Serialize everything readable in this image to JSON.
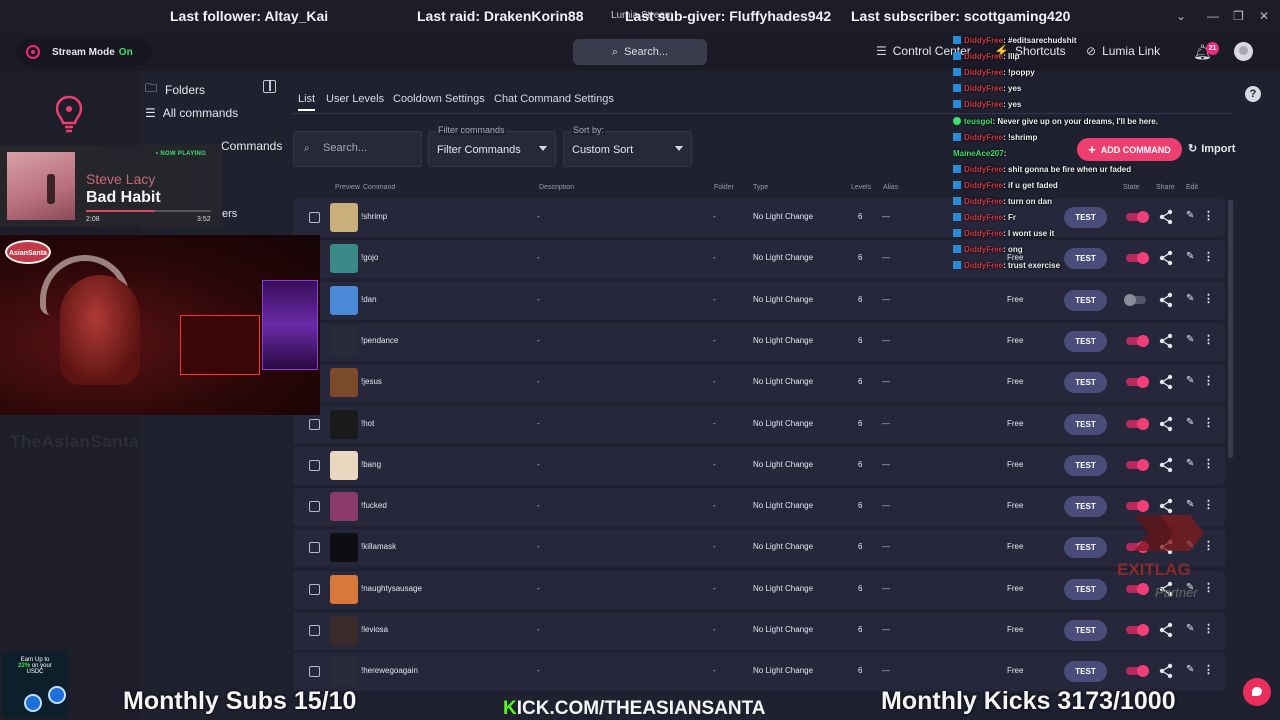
{
  "stream_stats": {
    "last_follower": "Last follower: Altay_Kai",
    "last_raid": "Last raid: DrakenKorin88",
    "last_sub_giver": "Last sub-giver: Fluffyhades942",
    "last_subscriber": "Last subscriber: scottgaming420",
    "app_title": "Lumia Stream"
  },
  "header": {
    "stream_mode_label": "Stream Mode",
    "stream_mode_state": "On",
    "search_label": "Search...",
    "control_center": "Control Center",
    "shortcuts": "Shortcuts",
    "lumia_link": "Lumia Link",
    "notification_count": "21"
  },
  "sidebar": {
    "folders_label": "Folders",
    "all_commands": "All commands",
    "chat_commands_partial": "Commands",
    "partial_item": "ers"
  },
  "now_playing": {
    "badge": "• NOW PLAYING",
    "artist": "Steve Lacy",
    "song": "Bad Habit",
    "elapsed": "2:08",
    "duration": "3:52",
    "progress": 0.55
  },
  "webcam": {
    "logo_text": "AsianSanta",
    "ghost_text": "TheAsianSanta"
  },
  "promo": {
    "line1": "Earn Up to",
    "line2_highlight": "22%",
    "line2_rest": "on your",
    "line3": "USDC"
  },
  "tabs": [
    "List",
    "User Levels",
    "Cooldown Settings",
    "Chat Command Settings"
  ],
  "filters": {
    "search_placeholder": "Search...",
    "filter_label": "Filter commands",
    "filter_value": "Filter Commands",
    "sort_label": "Sort by:",
    "sort_value": "Custom Sort"
  },
  "actions": {
    "add_command": "ADD COMMAND",
    "import": "Import"
  },
  "columns": {
    "preview": "Preview",
    "command": "Command",
    "description": "Description",
    "folder": "Folder",
    "type": "Type",
    "levels": "Levels",
    "alias": "Alias",
    "state": "State",
    "share": "Share",
    "edit": "Edit"
  },
  "rows": [
    {
      "name": "!shrimp",
      "desc": "-",
      "folder": "-",
      "type": "No Light Change",
      "levels": "6",
      "alias": "—",
      "perm": "",
      "test": "TEST",
      "enabled": true,
      "thumb": "#c9b07a"
    },
    {
      "name": "!gojo",
      "desc": "-",
      "folder": "-",
      "type": "No Light Change",
      "levels": "6",
      "alias": "—",
      "perm": "Free",
      "test": "TEST",
      "enabled": true,
      "thumb": "#3a8a8a"
    },
    {
      "name": "!dan",
      "desc": "-",
      "folder": "-",
      "type": "No Light Change",
      "levels": "6",
      "alias": "—",
      "perm": "Free",
      "test": "TEST",
      "enabled": false,
      "thumb": "#4a8ad8"
    },
    {
      "name": "!pendance",
      "desc": "-",
      "folder": "-",
      "type": "No Light Change",
      "levels": "6",
      "alias": "—",
      "perm": "Free",
      "test": "TEST",
      "enabled": true,
      "thumb": "#2a2b3a"
    },
    {
      "name": "!jesus",
      "desc": "-",
      "folder": "-",
      "type": "No Light Change",
      "levels": "6",
      "alias": "—",
      "perm": "Free",
      "test": "TEST",
      "enabled": true,
      "thumb": "#7a4a2a"
    },
    {
      "name": "!hot",
      "desc": "-",
      "folder": "-",
      "type": "No Light Change",
      "levels": "6",
      "alias": "—",
      "perm": "Free",
      "test": "TEST",
      "enabled": true,
      "thumb": "#1a1a1a"
    },
    {
      "name": "!bang",
      "desc": "-",
      "folder": "-",
      "type": "No Light Change",
      "levels": "6",
      "alias": "—",
      "perm": "Free",
      "test": "TEST",
      "enabled": true,
      "thumb": "#e8d8c0"
    },
    {
      "name": "!fucked",
      "desc": "-",
      "folder": "-",
      "type": "No Light Change",
      "levels": "6",
      "alias": "—",
      "perm": "Free",
      "test": "TEST",
      "enabled": true,
      "thumb": "#8a3a6a"
    },
    {
      "name": "!killamask",
      "desc": "-",
      "folder": "-",
      "type": "No Light Change",
      "levels": "6",
      "alias": "—",
      "perm": "Free",
      "test": "TEST",
      "enabled": true,
      "thumb": "#0e0e12"
    },
    {
      "name": "!naughtysausage",
      "desc": "-",
      "folder": "-",
      "type": "No Light Change",
      "levels": "6",
      "alias": "—",
      "perm": "Free",
      "test": "TEST",
      "enabled": true,
      "thumb": "#d8783a"
    },
    {
      "name": "!leviosa",
      "desc": "-",
      "folder": "-",
      "type": "No Light Change",
      "levels": "6",
      "alias": "—",
      "perm": "Free",
      "test": "TEST",
      "enabled": true,
      "thumb": "#3a2a2a"
    },
    {
      "name": "!herewegoagain",
      "desc": "-",
      "folder": "-",
      "type": "No Light Change",
      "levels": "6",
      "alias": "—",
      "perm": "Free",
      "test": "TEST",
      "enabled": true,
      "thumb": "#2a2b3a"
    }
  ],
  "chat": [
    {
      "user": "DiddyFree",
      "msg": ": #editsarechudshit",
      "badge": "blue",
      "user_color": "red"
    },
    {
      "user": "DiddyFree",
      "msg": ": lllp",
      "badge": "blue",
      "user_color": "red"
    },
    {
      "user": "DiddyFree",
      "msg": ": !poppy",
      "badge": "blue",
      "user_color": "red"
    },
    {
      "user": "DiddyFree",
      "msg": ": yes",
      "badge": "blue",
      "user_color": "red"
    },
    {
      "user": "DiddyFree",
      "msg": ": yes",
      "badge": "blue",
      "user_color": "red"
    },
    {
      "user": "teusgol",
      "msg": ": Never give up on your dreams, I'll be here.",
      "badge": "green",
      "user_color": "green"
    },
    {
      "user": "DiddyFree",
      "msg": ": !shrimp",
      "badge": "blue",
      "user_color": "red"
    },
    {
      "user": "MaineAce207",
      "msg": ":",
      "badge": "none",
      "user_color": "green"
    },
    {
      "user": "DiddyFree",
      "msg": ": shit gonna be fire when ur faded",
      "badge": "blue",
      "user_color": "red"
    },
    {
      "user": "DiddyFree",
      "msg": ": if u get faded",
      "badge": "blue",
      "user_color": "red"
    },
    {
      "user": "DiddyFree",
      "msg": ": turn on dan",
      "badge": "blue",
      "user_color": "red"
    },
    {
      "user": "DiddyFree",
      "msg": ": Fr",
      "badge": "blue",
      "user_color": "red"
    },
    {
      "user": "DiddyFree",
      "msg": ": I wont use it",
      "badge": "blue",
      "user_color": "red"
    },
    {
      "user": "DiddyFree",
      "msg": ": ong",
      "badge": "blue",
      "user_color": "red"
    },
    {
      "user": "DiddyFree",
      "msg": ": trust exercise",
      "badge": "blue",
      "user_color": "red"
    }
  ],
  "sponsor": {
    "brand": "EXITLAG",
    "tag": "Partner"
  },
  "bottom_overlay": {
    "monthly_subs": "Monthly Subs 15/10",
    "kick_k": "K",
    "kick_url": "ICK.COM/THEASIANSANTA",
    "monthly_kicks": "Monthly Kicks 3173/1000"
  },
  "colors": {
    "accent": "#ec3e6f",
    "toggle_on": "#f23f7a",
    "panel": "#1f2030",
    "row": "#26273a",
    "test_button": "#4a4c7a",
    "kick_green": "#53fc18"
  }
}
